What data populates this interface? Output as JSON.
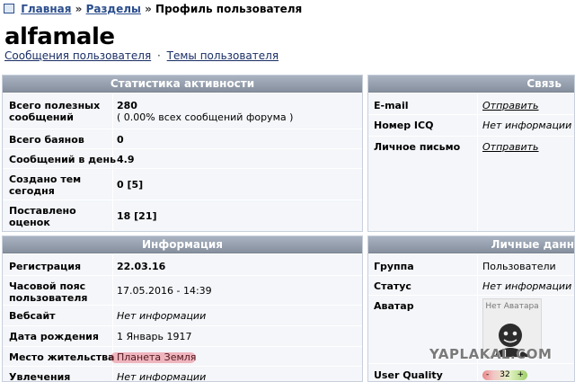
{
  "breadcrumb": {
    "home": "Главная",
    "sep": "»",
    "sections": "Разделы",
    "current": "Профиль пользователя"
  },
  "username": "alfamale",
  "sublinks": {
    "posts": "Сообщения пользователя",
    "dot": "·",
    "topics": "Темы пользователя"
  },
  "stats": {
    "title": "Статистика активности",
    "total_label": "Всего полезных сообщений",
    "total_value": "280",
    "total_pct": "( 0.00% всех сообщений форума )",
    "bayan_label": "Всего баянов",
    "bayan_value": "0",
    "perday_label": "Сообщений в день",
    "perday_value": "4.9",
    "topics_today_label": "Создано тем сегодня",
    "topics_today_value": "0 [5]",
    "ratings_today_label": "Поставлено оценок сегодня",
    "ratings_today_value": "18 [21]"
  },
  "contact": {
    "title": "Связь",
    "email_label": "E-mail",
    "email_value": "Отправить",
    "icq_label": "Номер ICQ",
    "icq_value": "Нет информации",
    "pm_label": "Личное письмо",
    "pm_value": "Отправить"
  },
  "info": {
    "title": "Информация",
    "reg_label": "Регистрация",
    "reg_value": "22.03.16",
    "tz_label": "Часовой пояс пользователя",
    "tz_value": "17.05.2016 - 14:39",
    "site_label": "Вебсайт",
    "site_value": "Нет информации",
    "dob_label": "Дата рождения",
    "dob_value": "1 Январь 1917",
    "loc_label": "Место жительства",
    "loc_value": "Планета Земля",
    "hobby_label": "Увлечения",
    "hobby_value": "Нет информации"
  },
  "personal": {
    "title": "Личные данн",
    "group_label": "Группа",
    "group_value": "Пользователи",
    "status_label": "Статус",
    "status_value": "Нет информации",
    "avatar_label": "Аватар",
    "avatar_caption": "Нет Аватара",
    "quality_label": "User Quality",
    "quality_value": "32",
    "quality_minus": "-",
    "quality_plus": "+"
  },
  "watermark": "YAPLAKAL.COM",
  "colors": {
    "link": "#2a4d8c",
    "panel_head": "#969fad",
    "panel_bg": "#f4f6f9"
  }
}
